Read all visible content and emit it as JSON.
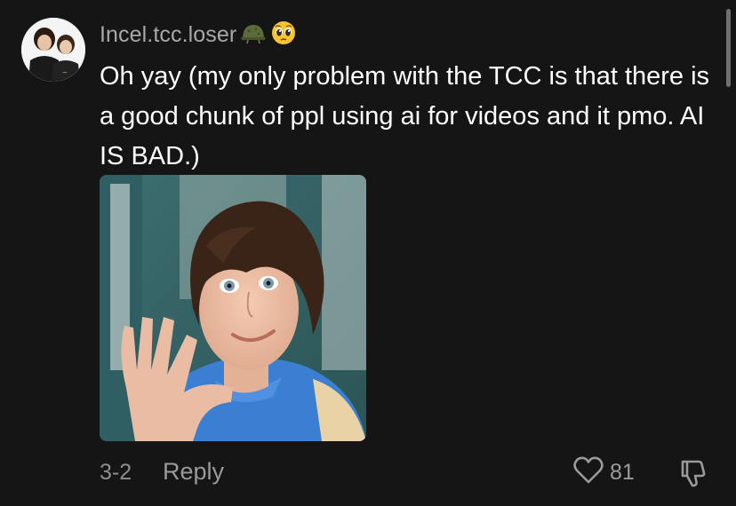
{
  "comment": {
    "username": "Incel.tcc.loser",
    "username_emojis": [
      "helmet-emoji",
      "pleading-face-emoji"
    ],
    "text": "Oh yay (my only problem with the TCC is that there is a good chunk of ppl using ai for videos and it pmo. AI IS BAD.)",
    "date": "3-2",
    "reply_label": "Reply",
    "like_count": "81"
  },
  "icons": {
    "like": "heart-icon",
    "dislike": "thumbs-down-icon"
  },
  "colors": {
    "background": "#151515",
    "username": "#a8a8a8",
    "body_text": "#ffffff",
    "meta_text": "#8e8e8e"
  }
}
